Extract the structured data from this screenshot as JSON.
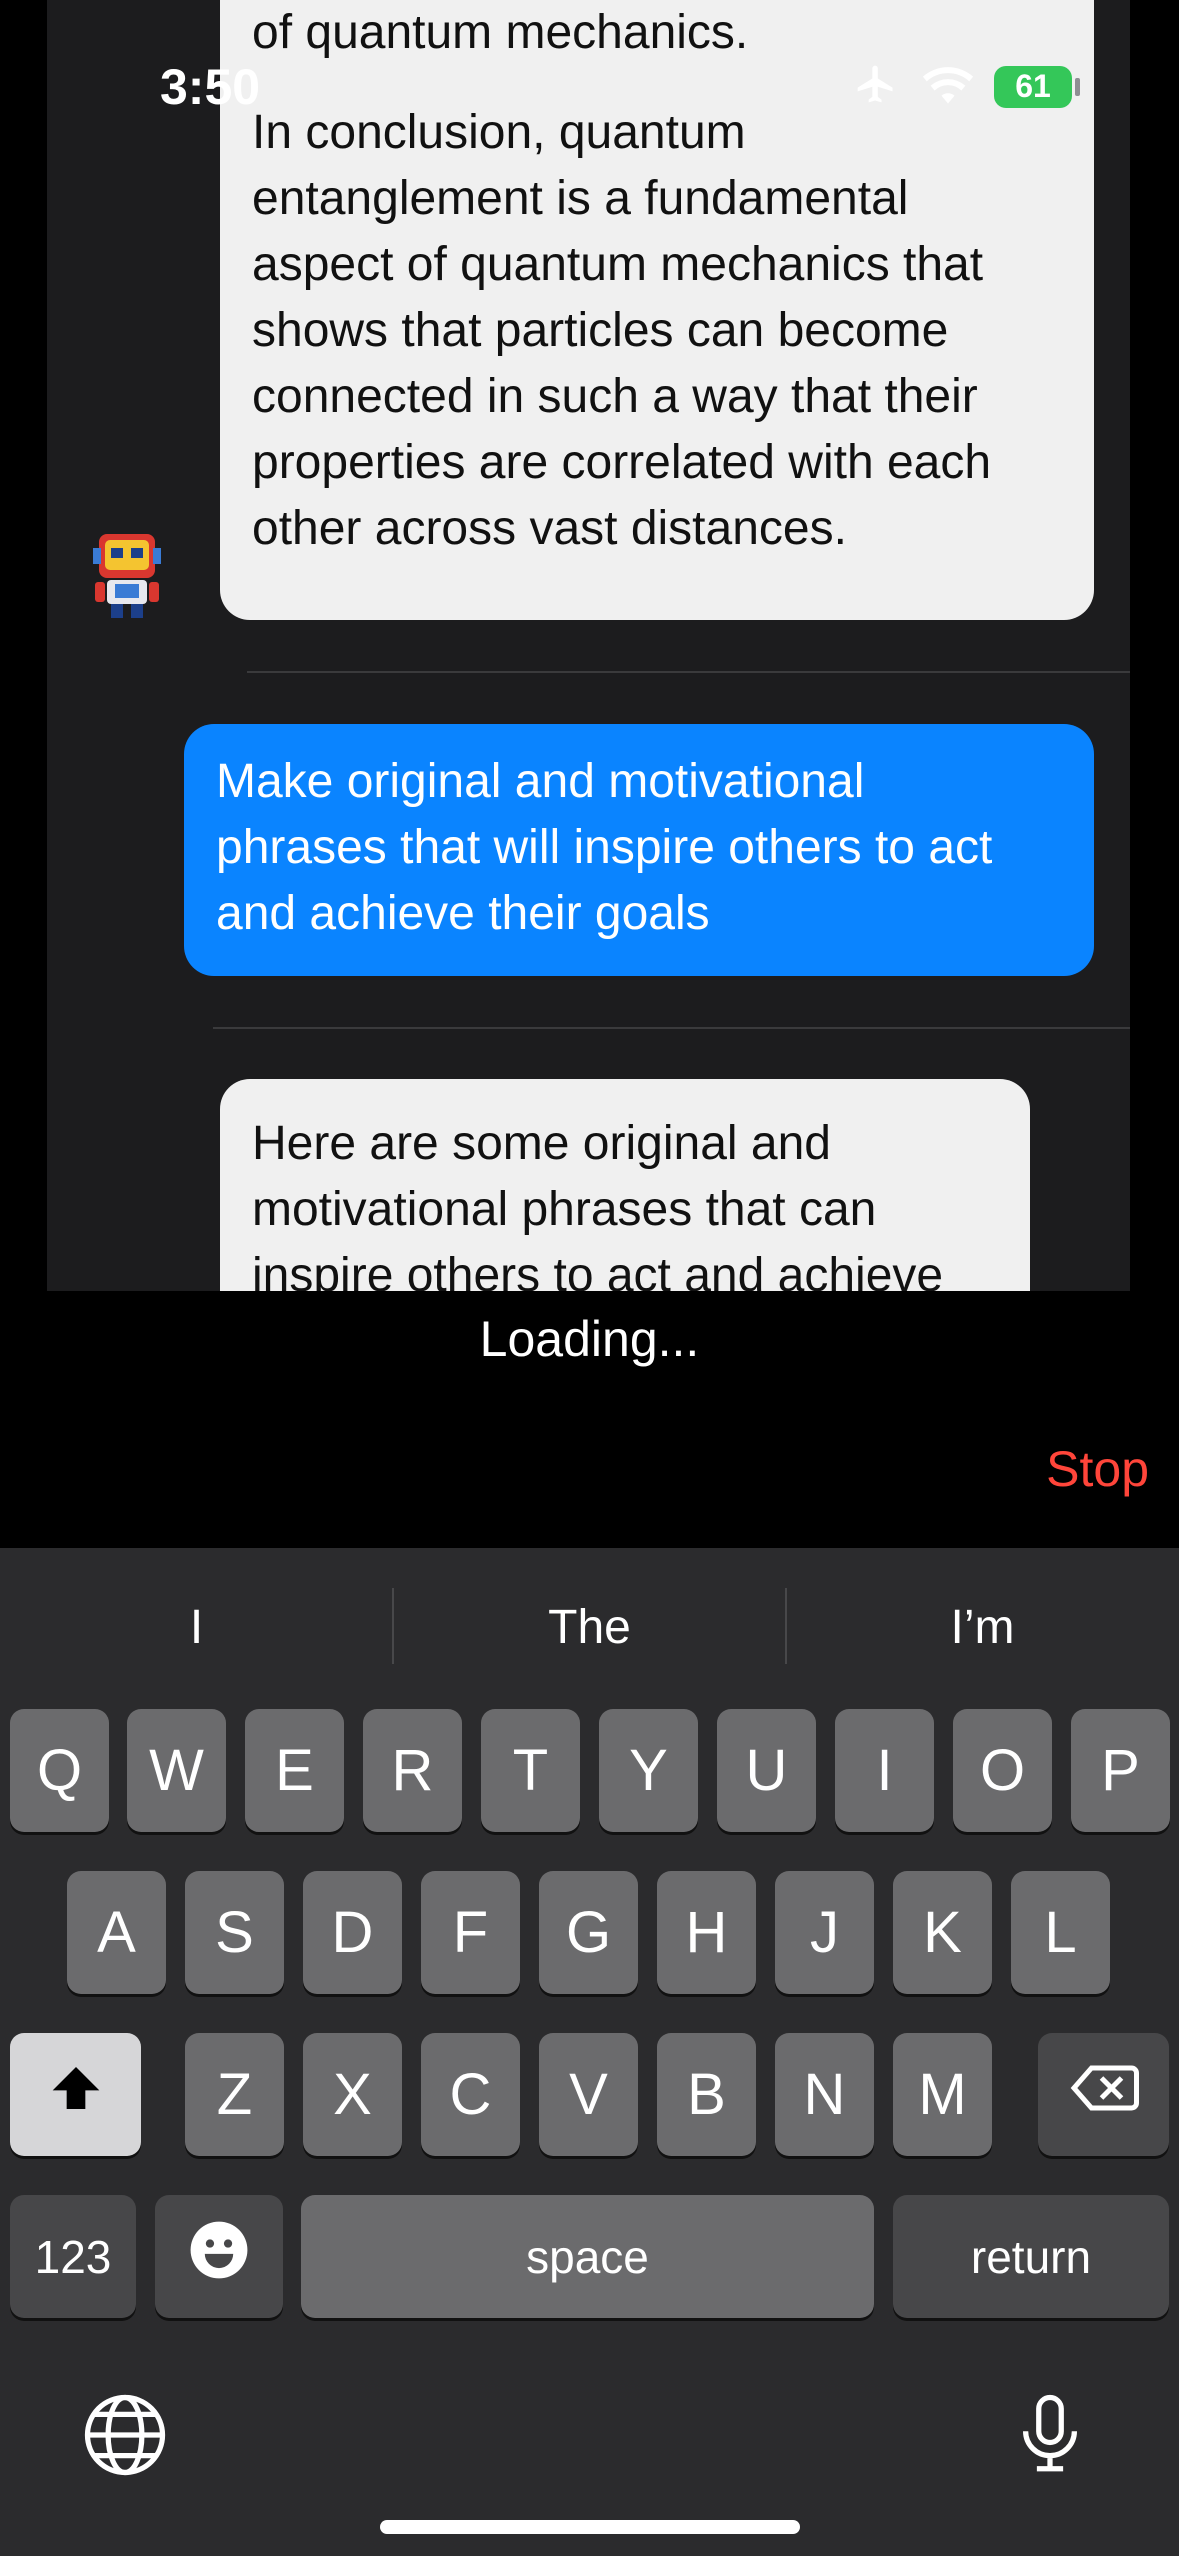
{
  "status": {
    "time": "3:50",
    "battery": "61"
  },
  "chat": {
    "ai_msg_1_prev": "of quantum mechanics.",
    "ai_msg_1_lines": [
      "In conclusion, quantum",
      "entanglement is a fundamental",
      "aspect of quantum mechanics that",
      "shows that particles can become",
      "connected in such a way that their",
      "properties are correlated with each",
      "other across vast distances."
    ],
    "user_msg_lines": [
      "Make original and motivational",
      "phrases that will inspire others to act",
      "and achieve their goals"
    ],
    "ai_msg_2_lines": [
      "Here are some original and",
      "motivational phrases that can",
      "inspire others to act and achieve"
    ]
  },
  "loading_text": "Loading...",
  "stop_label": "Stop",
  "keyboard": {
    "suggestions": [
      "I",
      "The",
      "I’m"
    ],
    "row1": [
      "Q",
      "W",
      "E",
      "R",
      "T",
      "Y",
      "U",
      "I",
      "O",
      "P"
    ],
    "row2": [
      "A",
      "S",
      "D",
      "F",
      "G",
      "H",
      "J",
      "K",
      "L"
    ],
    "row3": [
      "Z",
      "X",
      "C",
      "V",
      "B",
      "N",
      "M"
    ],
    "numbers_label": "123",
    "space_label": "space",
    "return_label": "return"
  },
  "colors": {
    "user_bubble": "#0a84ff",
    "stop": "#ff453a",
    "battery": "#34c759"
  },
  "icons": [
    "airplane-icon",
    "wifi-icon",
    "battery-icon",
    "shift-icon",
    "backspace-icon",
    "emoji-icon",
    "globe-icon",
    "microphone-icon"
  ]
}
